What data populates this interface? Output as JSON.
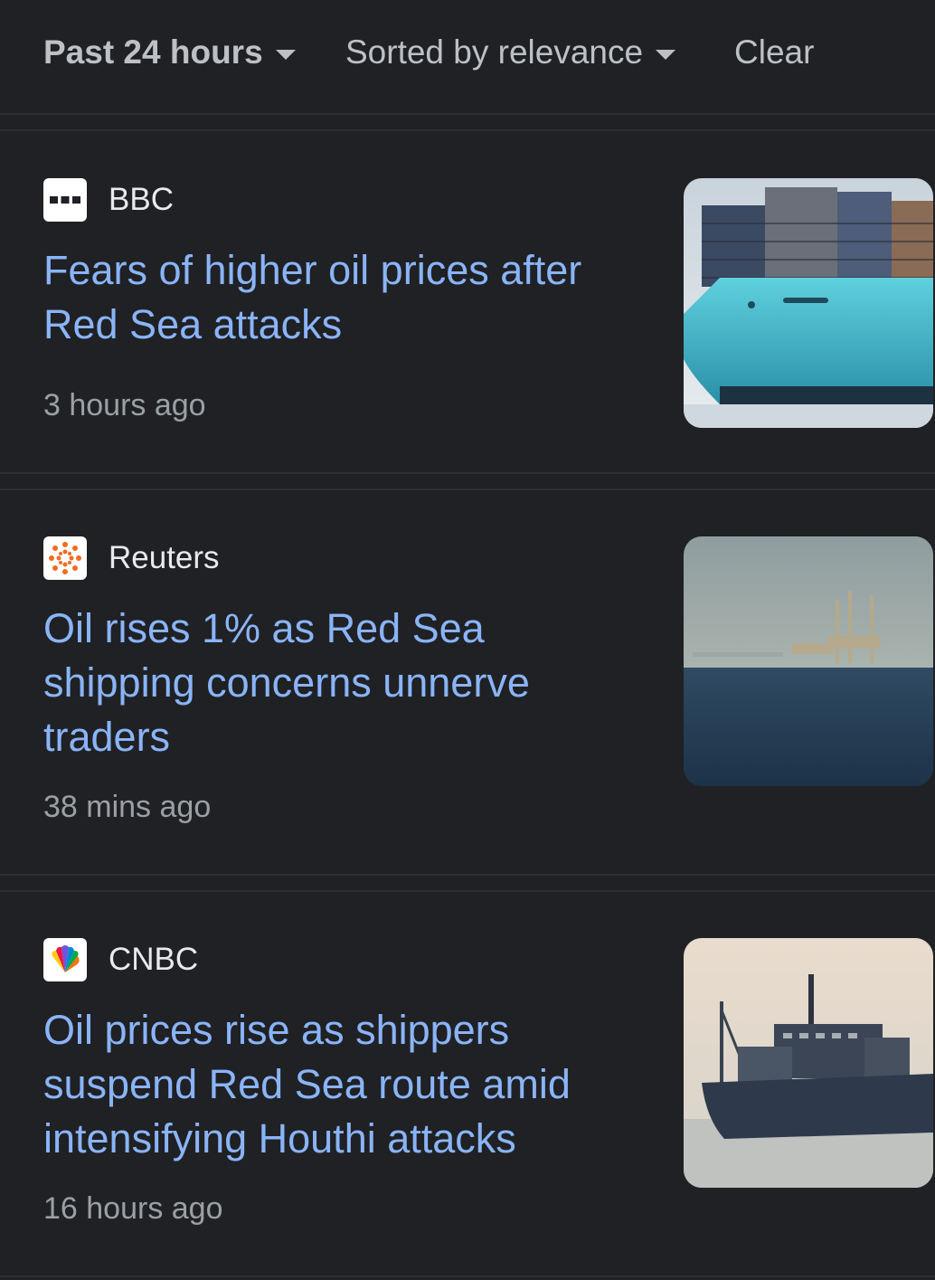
{
  "filters": {
    "time": "Past 24 hours",
    "sort": "Sorted by relevance",
    "clear": "Clear"
  },
  "articles": [
    {
      "source": "BBC",
      "favicon": "bbc-logo-icon",
      "headline": "Fears of higher oil prices after Red Sea attacks",
      "time": "3 hours ago",
      "thumbnail": "container-ship-photo"
    },
    {
      "source": "Reuters",
      "favicon": "reuters-logo-icon",
      "headline": "Oil rises 1% as Red Sea shipping concerns unnerve traders",
      "time": "38 mins ago",
      "thumbnail": "oil-rig-at-sea-photo"
    },
    {
      "source": "CNBC",
      "favicon": "cnbc-peacock-logo-icon",
      "headline": "Oil prices rise as shippers suspend Red Sea route amid intensifying Houthi attacks",
      "time": "16 hours ago",
      "thumbnail": "cargo-ship-photo"
    }
  ],
  "colors": {
    "background": "#202124",
    "headline": "#8ab4f8",
    "source": "#e8eaed",
    "meta": "#9aa0a6"
  }
}
